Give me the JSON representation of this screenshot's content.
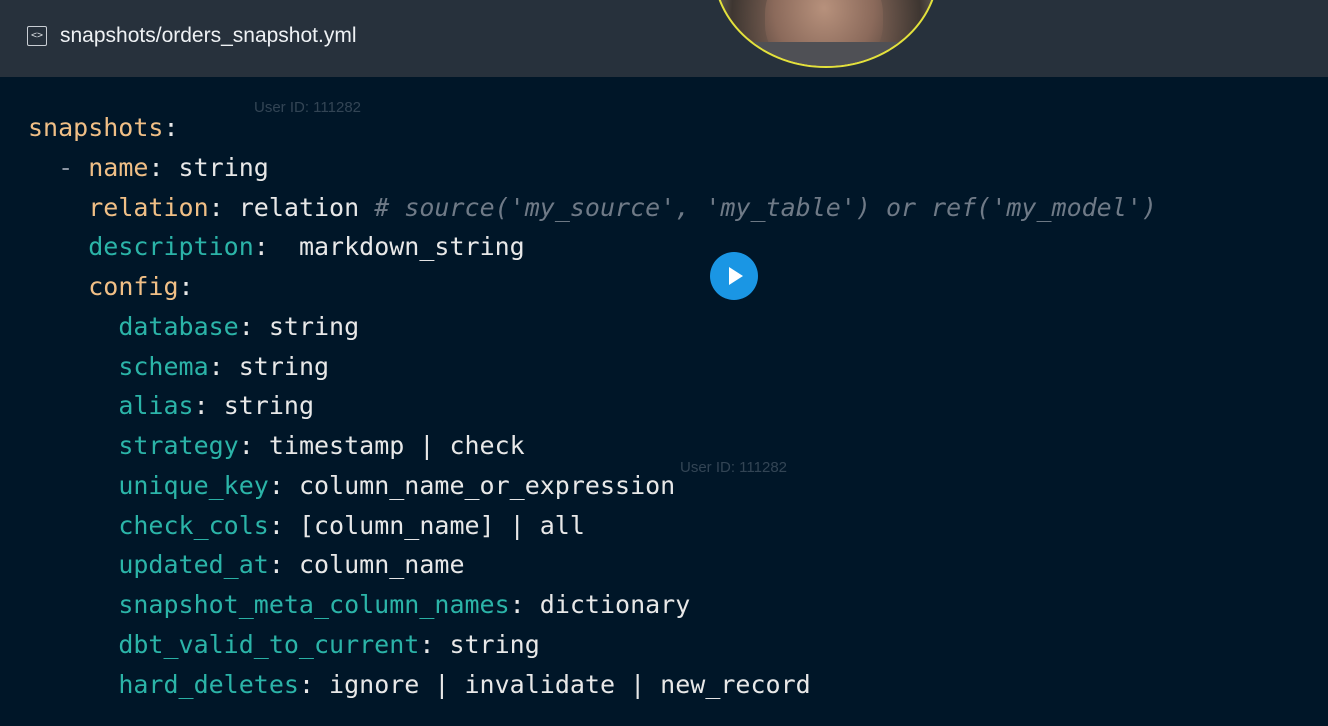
{
  "header": {
    "file_icon": "code-file-icon",
    "file_path": "snapshots/orders_snapshot.yml"
  },
  "video": {
    "play_icon": "play-icon",
    "watermark": "User ID: 111282"
  },
  "colors": {
    "background": "#001628",
    "header_bg": "#27313c",
    "top_key": "#f0bf86",
    "sub_key": "#2bb4a8",
    "comment": "#6f7a87",
    "play_button": "#1a96e4",
    "webcam_border": "#e3e13c"
  },
  "code": {
    "line1": {
      "key": "snapshots",
      "sep": ":"
    },
    "line2": {
      "dash": "- ",
      "key": "name",
      "sep": ": ",
      "value": "string"
    },
    "line3": {
      "key": "relation",
      "sep": ": ",
      "value": "relation ",
      "comment": "# source('my_source', 'my_table') or ref('my_model')"
    },
    "line4": {
      "key": "description",
      "sep": ":  ",
      "value": "markdown_string"
    },
    "line5": {
      "key": "config",
      "sep": ":"
    },
    "line6": {
      "key": "database",
      "sep": ": ",
      "value": "string"
    },
    "line7": {
      "key": "schema",
      "sep": ": ",
      "value": "string"
    },
    "line8": {
      "key": "alias",
      "sep": ": ",
      "value": "string"
    },
    "line9": {
      "key": "strategy",
      "sep": ": ",
      "value": "timestamp | check"
    },
    "line10": {
      "key": "unique_key",
      "sep": ": ",
      "value": "column_name_or_expression"
    },
    "line11": {
      "key": "check_cols",
      "sep": ": ",
      "value": "[column_name] | all"
    },
    "line12": {
      "key": "updated_at",
      "sep": ": ",
      "value": "column_name"
    },
    "line13": {
      "key": "snapshot_meta_column_names",
      "sep": ": ",
      "value": "dictionary"
    },
    "line14": {
      "key": "dbt_valid_to_current",
      "sep": ": ",
      "value": "string"
    },
    "line15": {
      "key": "hard_deletes",
      "sep": ": ",
      "value": "ignore | invalidate | new_record"
    }
  }
}
